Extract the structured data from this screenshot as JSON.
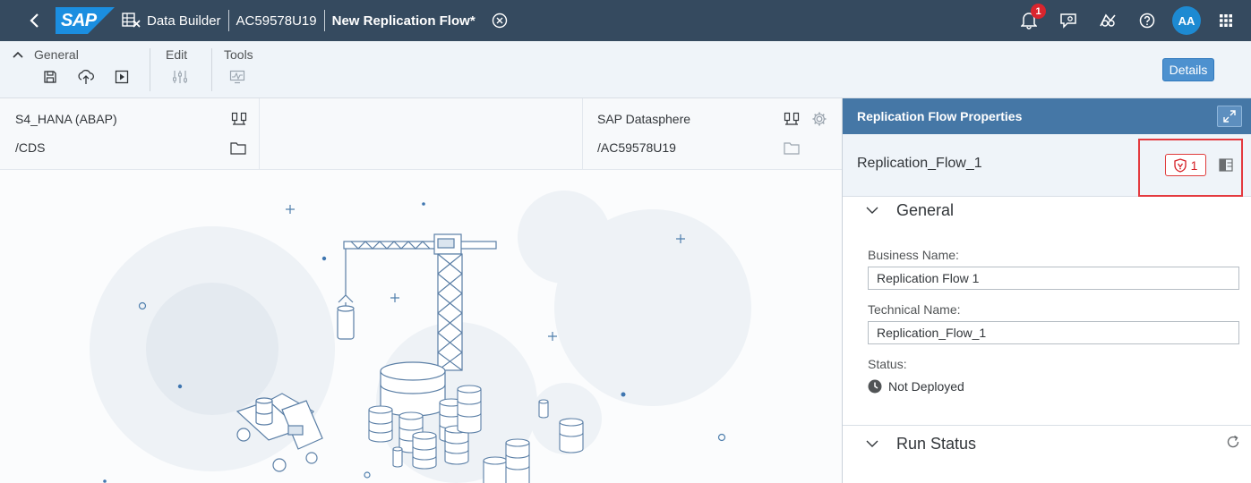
{
  "shell": {
    "logo_text": "SAP",
    "app_name": "Data Builder",
    "space_id": "AC59578U19",
    "document_title": "New Replication Flow",
    "unsaved_marker": "*",
    "notification_count": "1",
    "user_initials": "AA",
    "colors": {
      "bar": "#354a5f",
      "avatar": "#1d8ad2",
      "badge": "#d9252e"
    }
  },
  "toolbar": {
    "groups": [
      {
        "label": "General",
        "icons": [
          "save-icon",
          "deploy-icon",
          "run-icon"
        ]
      },
      {
        "label": "Edit",
        "icons": [
          "settings-sliders-icon"
        ]
      },
      {
        "label": "Tools",
        "icons": [
          "monitor-icon"
        ]
      }
    ],
    "details_label": "Details"
  },
  "source": {
    "connection": "S4_HANA (ABAP)",
    "container": "/CDS"
  },
  "target": {
    "connection": "SAP Datasphere",
    "container": "/AC59578U19"
  },
  "panel": {
    "header_title": "Replication Flow Properties",
    "object_title": "Replication_Flow_1",
    "error_count": "1",
    "general": {
      "section_title": "General",
      "business_name_label": "Business Name:",
      "business_name_value": "Replication Flow 1",
      "technical_name_label": "Technical Name:",
      "technical_name_value": "Replication_Flow_1",
      "status_label": "Status:",
      "status_value": "Not Deployed"
    },
    "run_status": {
      "section_title": "Run Status"
    },
    "colors": {
      "header": "#4577a6",
      "error": "#d51f25",
      "highlight": "#e43a3f"
    }
  }
}
